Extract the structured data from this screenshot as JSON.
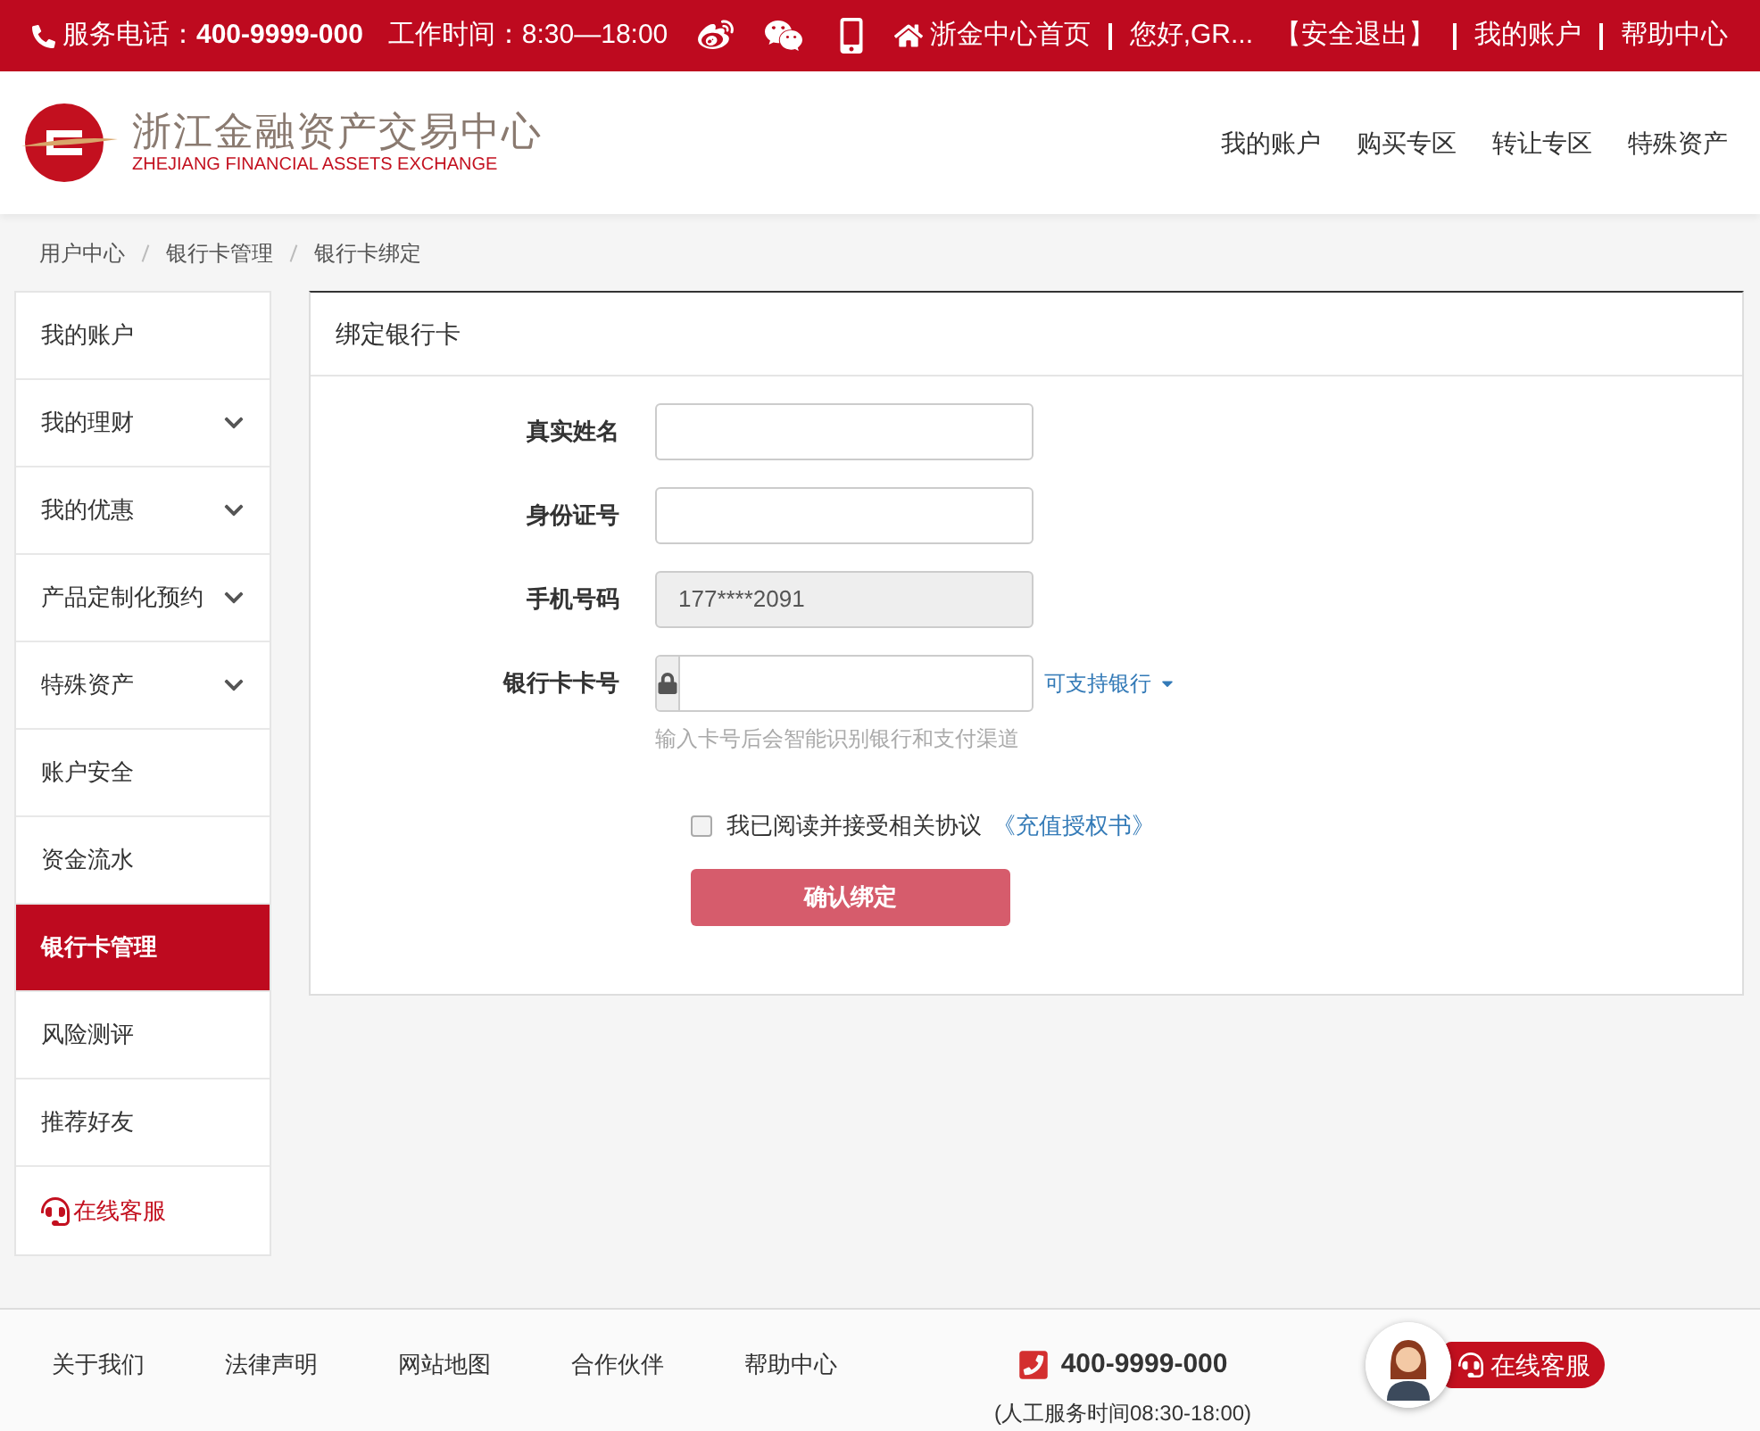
{
  "top_bar": {
    "hotline_label": "服务电话：",
    "hotline": "400-9999-000",
    "hours": "工作时间：8:30—18:00",
    "links": [
      {
        "kind": "home",
        "label": "浙金中心首页"
      },
      {
        "kind": "plain",
        "label": "您好,GR..."
      },
      {
        "kind": "plain",
        "label": "【安全退出】"
      },
      {
        "kind": "plain",
        "label": "我的账户"
      },
      {
        "kind": "plain",
        "label": "帮助中心"
      }
    ]
  },
  "header": {
    "logo_cn": "浙江金融资产交易中心",
    "logo_en": "ZHEJIANG FINANCIAL ASSETS EXCHANGE",
    "nav": [
      "我的账户",
      "购买专区",
      "转让专区",
      "特殊资产"
    ]
  },
  "breadcrumb": [
    "用户中心",
    "银行卡管理",
    "银行卡绑定"
  ],
  "sidebar": [
    {
      "kind": "link",
      "label": "我的账户",
      "selected": false
    },
    {
      "kind": "menu",
      "label": "我的理财",
      "selected": false
    },
    {
      "kind": "menu",
      "label": "我的优惠",
      "selected": false
    },
    {
      "kind": "menu",
      "label": "产品定制化预约",
      "selected": false
    },
    {
      "kind": "menu",
      "label": "特殊资产",
      "selected": false
    },
    {
      "kind": "link",
      "label": "账户安全",
      "selected": false
    },
    {
      "kind": "link",
      "label": "资金流水",
      "selected": false
    },
    {
      "kind": "link",
      "label": "银行卡管理",
      "selected": true
    },
    {
      "kind": "link",
      "label": "风险测评",
      "selected": false
    },
    {
      "kind": "link",
      "label": "推荐好友",
      "selected": false
    },
    {
      "kind": "service",
      "label": "在线客服",
      "selected": false
    }
  ],
  "panel": {
    "title": "绑定银行卡",
    "fields": [
      {
        "kind": "text",
        "label": "真实姓名"
      },
      {
        "kind": "text",
        "label": "身份证号"
      },
      {
        "kind": "disabled",
        "label": "手机号码",
        "value": "177****2091"
      },
      {
        "kind": "card",
        "label": "银行卡卡号",
        "link": "可支持银行",
        "hint": "输入卡号后会智能识别银行和支付渠道"
      }
    ],
    "agreement": {
      "checked": false,
      "label": "我已阅读并接受相关协议",
      "link": "《充值授权书》"
    },
    "submit": "确认绑定"
  },
  "footer": {
    "links": [
      "关于我们",
      "法律声明",
      "网站地图",
      "合作伙伴",
      "帮助中心"
    ],
    "phone": "400-9999-000",
    "hours": "(人工服务时间08:30-18:00)",
    "service": "在线客服"
  }
}
